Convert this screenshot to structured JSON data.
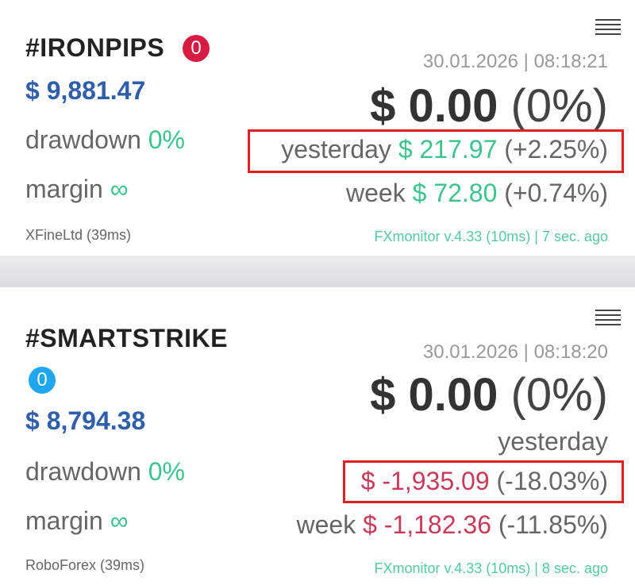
{
  "accounts": [
    {
      "name": "#IRONPIPS",
      "badge": "0",
      "balance": "$ 9,881.47",
      "drawdown_label": "drawdown",
      "drawdown_value": "0%",
      "margin_label": "margin",
      "margin_value": "∞",
      "broker": "XFineLtd (39ms)",
      "timestamp": "30.01.2026 | 08:18:21",
      "profit_amount": "$ 0.00",
      "profit_pct": "(0%)",
      "yesterday_label": "yesterday",
      "yesterday_amount": "$ 217.97",
      "yesterday_pct": "(+2.25%)",
      "week_label": "week",
      "week_amount": "$ 72.80",
      "week_pct": "(+0.74%)",
      "footer": "FXmonitor v.4.33 (10ms) | 7 sec. ago"
    },
    {
      "name": "#SMARTSTRIKE",
      "badge": "0",
      "balance": "$ 8,794.38",
      "drawdown_label": "drawdown",
      "drawdown_value": "0%",
      "margin_label": "margin",
      "margin_value": "∞",
      "broker": "RoboForex (39ms)",
      "timestamp": "30.01.2026 | 08:18:20",
      "profit_amount": "$ 0.00",
      "profit_pct": "(0%)",
      "yesterday_label": "yesterday",
      "yesterday_amount": "$ -1,935.09",
      "yesterday_pct": "(-18.03%)",
      "week_label": "week",
      "week_amount": "$ -1,182.36",
      "week_pct": "(-11.85%)",
      "footer": "FXmonitor v.4.33 (10ms) | 8 sec. ago"
    }
  ],
  "colors": {
    "positive": "#3cc48c",
    "negative": "#c83a5a",
    "balance": "#2f5fab",
    "badge_red": "#d81b43",
    "badge_blue": "#1ea6ee",
    "highlight": "#e3201f"
  },
  "icons": [
    "menu-icon"
  ]
}
